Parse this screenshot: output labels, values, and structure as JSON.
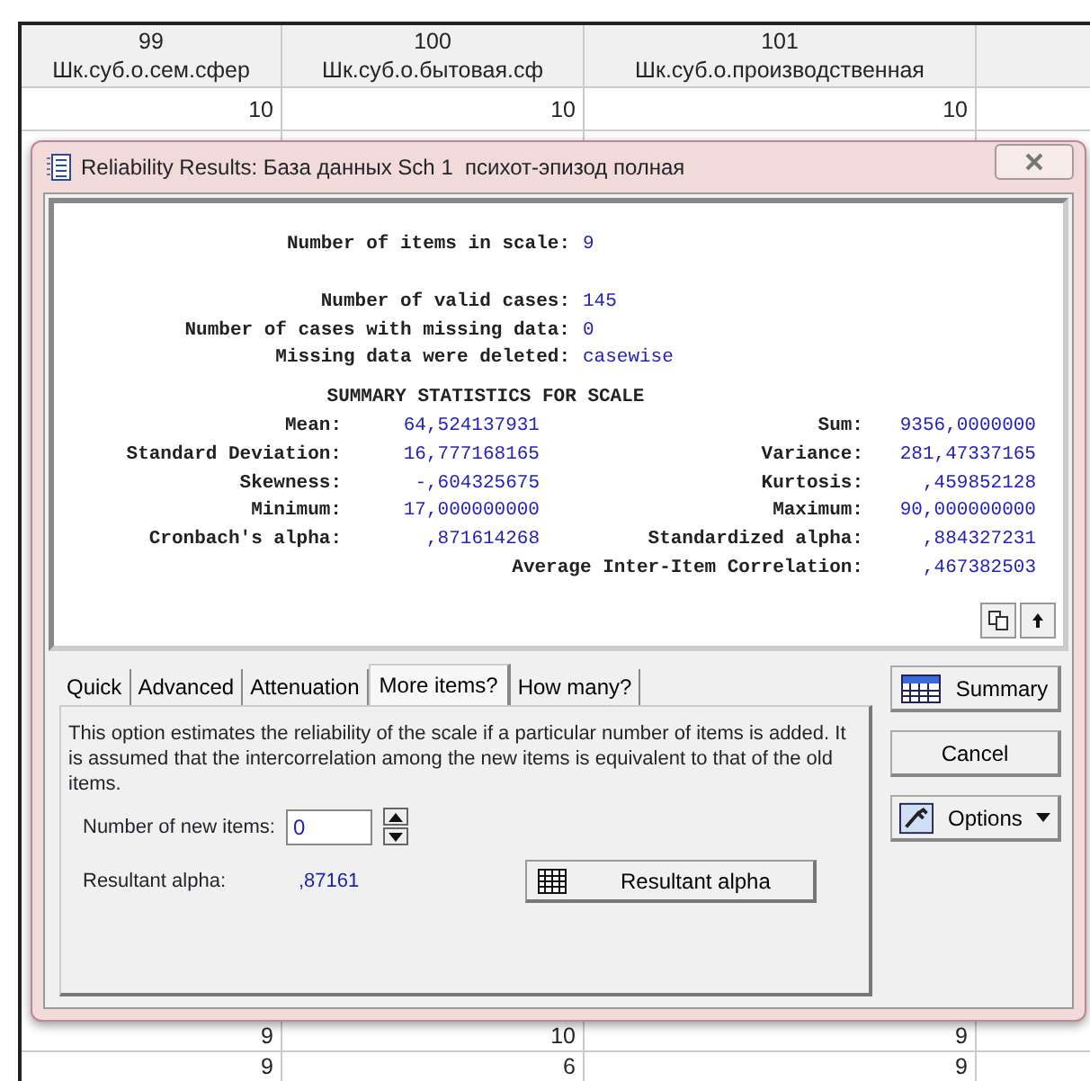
{
  "spreadsheet": {
    "columns": [
      {
        "number": "99",
        "name": "Шк.суб.о.сем.сфер"
      },
      {
        "number": "100",
        "name": "Шк.суб.о.бытовая.сф"
      },
      {
        "number": "101",
        "name": "Шк.суб.о.производственная"
      }
    ],
    "rows": [
      [
        "10",
        "10",
        "10"
      ],
      [
        "9",
        "10",
        "9"
      ],
      [
        "9",
        "6",
        "9"
      ]
    ]
  },
  "dialog": {
    "title": "Reliability Results: База данных Sch 1  психот-эпизод полная",
    "output": {
      "scale": [
        {
          "label": "Number of items in scale:",
          "value": "9"
        }
      ],
      "cases": [
        {
          "label": "Number of valid cases:",
          "value": "145"
        },
        {
          "label": "Number of cases with missing data:",
          "value": "0"
        },
        {
          "label": "Missing data were deleted:",
          "value": "casewise"
        }
      ],
      "summary_title": "SUMMARY STATISTICS FOR SCALE",
      "stats": [
        {
          "left": {
            "label": "Mean:",
            "value": "64,524137931"
          },
          "right": {
            "label": "Sum:",
            "value": "9356,0000000"
          }
        },
        {
          "left": {
            "label": "Standard Deviation:",
            "value": "16,777168165"
          },
          "right": {
            "label": "Variance:",
            "value": "281,47337165"
          }
        },
        {
          "left": {
            "label": "Skewness:",
            "value": "-,604325675"
          },
          "right": {
            "label": "Kurtosis:",
            "value": ",459852128"
          }
        },
        {
          "left": {
            "label": "Minimum:",
            "value": "17,000000000"
          },
          "right": {
            "label": "Maximum:",
            "value": "90,000000000"
          }
        },
        {
          "left": {
            "label": "Cronbach's alpha:",
            "value": ",871614268"
          },
          "right": {
            "label": "Standardized alpha:",
            "value": ",884327231"
          }
        },
        {
          "right": {
            "label": "Average Inter-Item Correlation:",
            "value": ",467382503"
          }
        }
      ]
    },
    "tabs": [
      {
        "label": "Quick",
        "selected": false
      },
      {
        "label": "Advanced",
        "selected": false
      },
      {
        "label": "Attenuation",
        "selected": false
      },
      {
        "label": "More items?",
        "selected": true
      },
      {
        "label": "How many?",
        "selected": false
      }
    ],
    "panel": {
      "description": "This option estimates the reliability of the scale if a particular number of items is added.  It is assumed that the intercorrelation among the new items is equivalent to that of the old items.",
      "new_items": {
        "label": "Number of new items:",
        "value": "0"
      },
      "resultant": {
        "label": "Resultant alpha:",
        "value": ",87161"
      },
      "button": "Resultant alpha"
    },
    "side_buttons": [
      {
        "kind": "summary",
        "label": "Summary"
      },
      {
        "kind": "plain",
        "label": "Cancel"
      },
      {
        "kind": "options",
        "label": "Options"
      }
    ]
  }
}
